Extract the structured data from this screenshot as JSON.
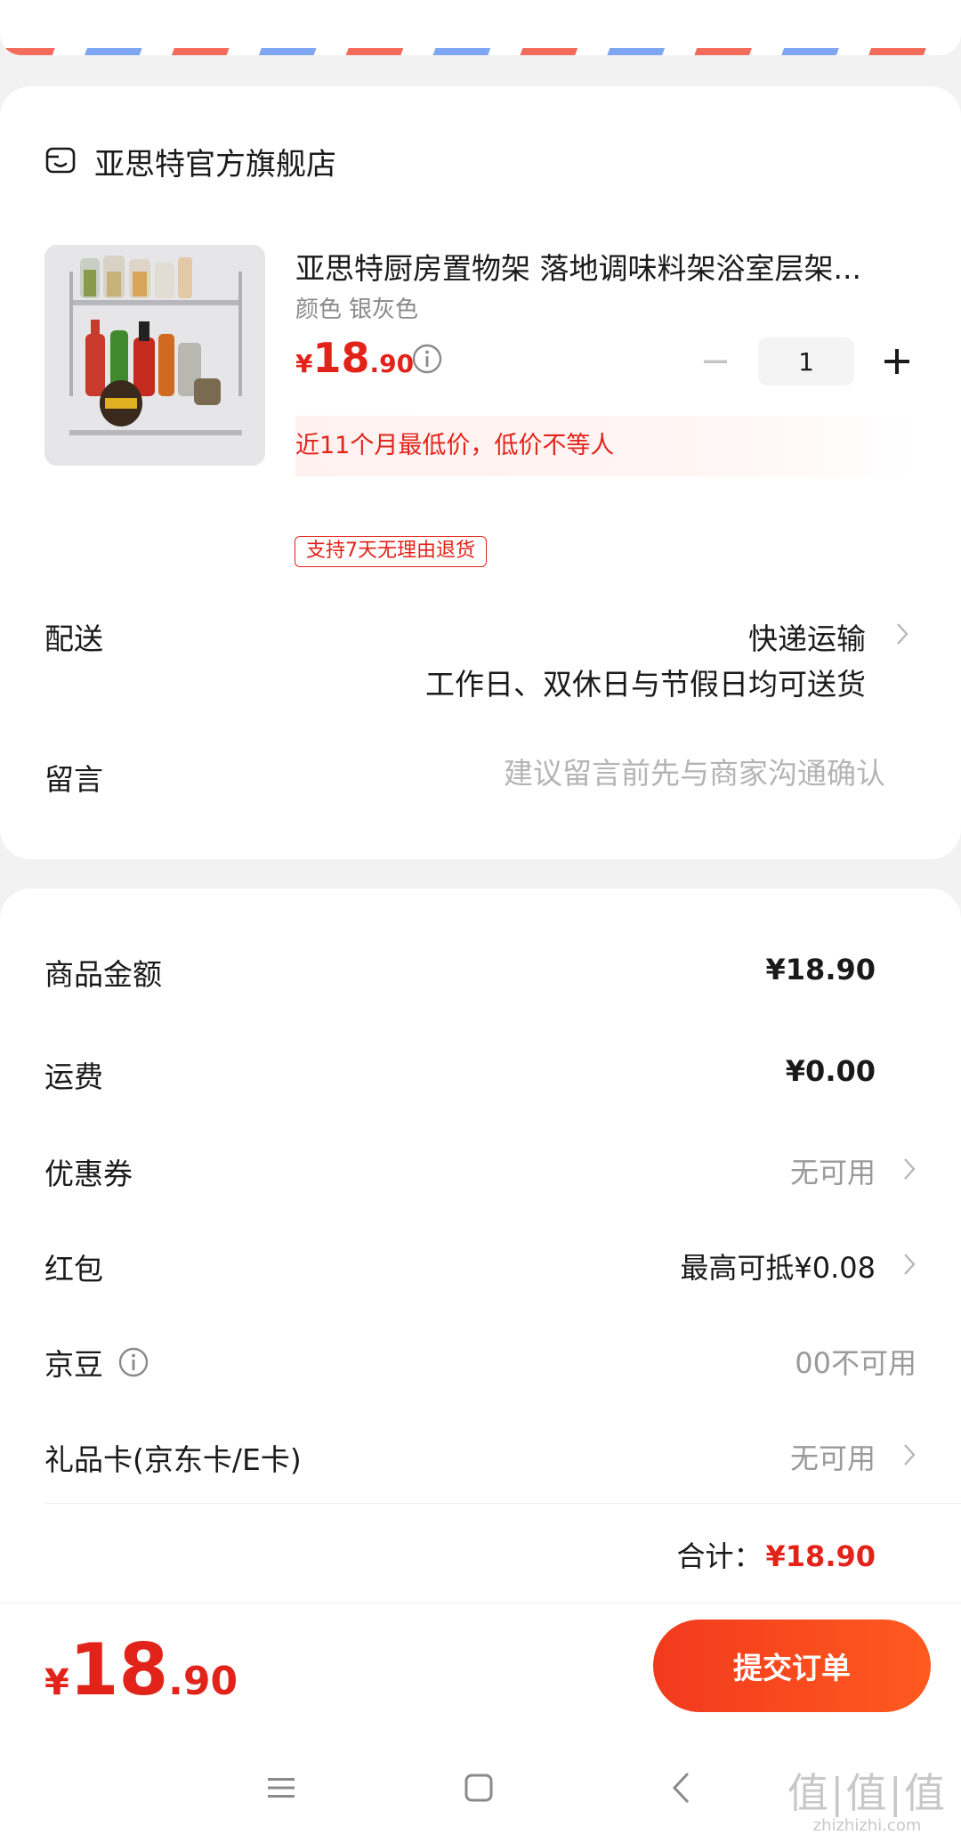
{
  "shop": {
    "name": "亚思特官方旗舰店",
    "icon": "shop-icon"
  },
  "product": {
    "title": "亚思特厨房置物架 落地调味料架浴室层架...",
    "spec_label": "颜色",
    "spec_value": "银灰色",
    "price": {
      "currency": "¥",
      "integer": "18",
      "decimal": ".90"
    },
    "quantity": "1",
    "lowest_price_note": "近11个月最低价，低价不等人",
    "return_policy": "支持7天无理由退货"
  },
  "delivery": {
    "label": "配送",
    "method": "快递运输",
    "description": "工作日、双休日与节假日均可送货"
  },
  "message": {
    "label": "留言",
    "placeholder": "建议留言前先与商家沟通确认"
  },
  "summary": {
    "items": [
      {
        "label": "商品金额",
        "value": "¥18.90"
      },
      {
        "label": "运费",
        "value": "¥0.00"
      },
      {
        "label": "优惠券",
        "value": "无可用"
      },
      {
        "label": "红包",
        "value": "最高可抵¥0.08"
      },
      {
        "label": "京豆",
        "value": "00不可用"
      },
      {
        "label": "礼品卡(京东卡/E卡)",
        "value": "无可用"
      }
    ],
    "total_label": "合计：",
    "total_value": "¥18.90"
  },
  "bottom_bar": {
    "price": {
      "currency": "¥",
      "integer": "18",
      "decimal": ".90"
    },
    "submit_label": "提交订单"
  },
  "watermark": {
    "main": "值|值|值",
    "sub": "zhizhizhi.com"
  },
  "colors": {
    "accent": "#e2231a",
    "button_start": "#f23a1e",
    "button_end": "#ff5a1f"
  }
}
